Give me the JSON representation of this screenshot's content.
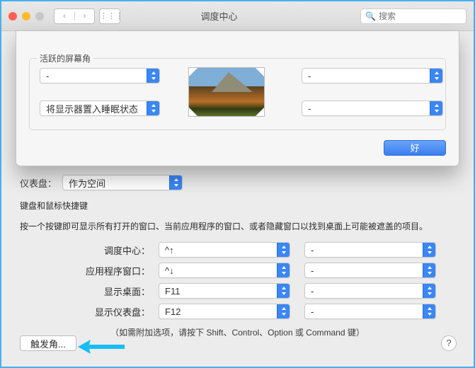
{
  "titlebar": {
    "title": "调度中心",
    "search_placeholder": "搜索"
  },
  "sheet": {
    "group_label": "活跃的屏幕角",
    "corners": {
      "top_left": "-",
      "top_right": "-",
      "bottom_left": "将显示器置入睡眠状态",
      "bottom_right": "-"
    },
    "ok_label": "好"
  },
  "behind": {
    "label_fragment": "仪表盘：",
    "value": "作为空间"
  },
  "shortcuts": {
    "title": "键盘和鼠标快捷键",
    "desc": "按一个按键即可显示所有打开的窗口、当前应用程序的窗口、或者隐藏窗口以找到桌面上可能被遮盖的项目。",
    "rows": [
      {
        "label": "调度中心：",
        "key": "^↑",
        "mouse": "-"
      },
      {
        "label": "应用程序窗口：",
        "key": "^↓",
        "mouse": "-"
      },
      {
        "label": "显示桌面：",
        "key": "F11",
        "mouse": "-"
      },
      {
        "label": "显示仪表盘：",
        "key": "F12",
        "mouse": "-"
      }
    ],
    "footnote": "（如需附加选项，请按下 Shift、Control、Option 或 Command 键）"
  },
  "buttons": {
    "hot_corners": "触发角..."
  }
}
